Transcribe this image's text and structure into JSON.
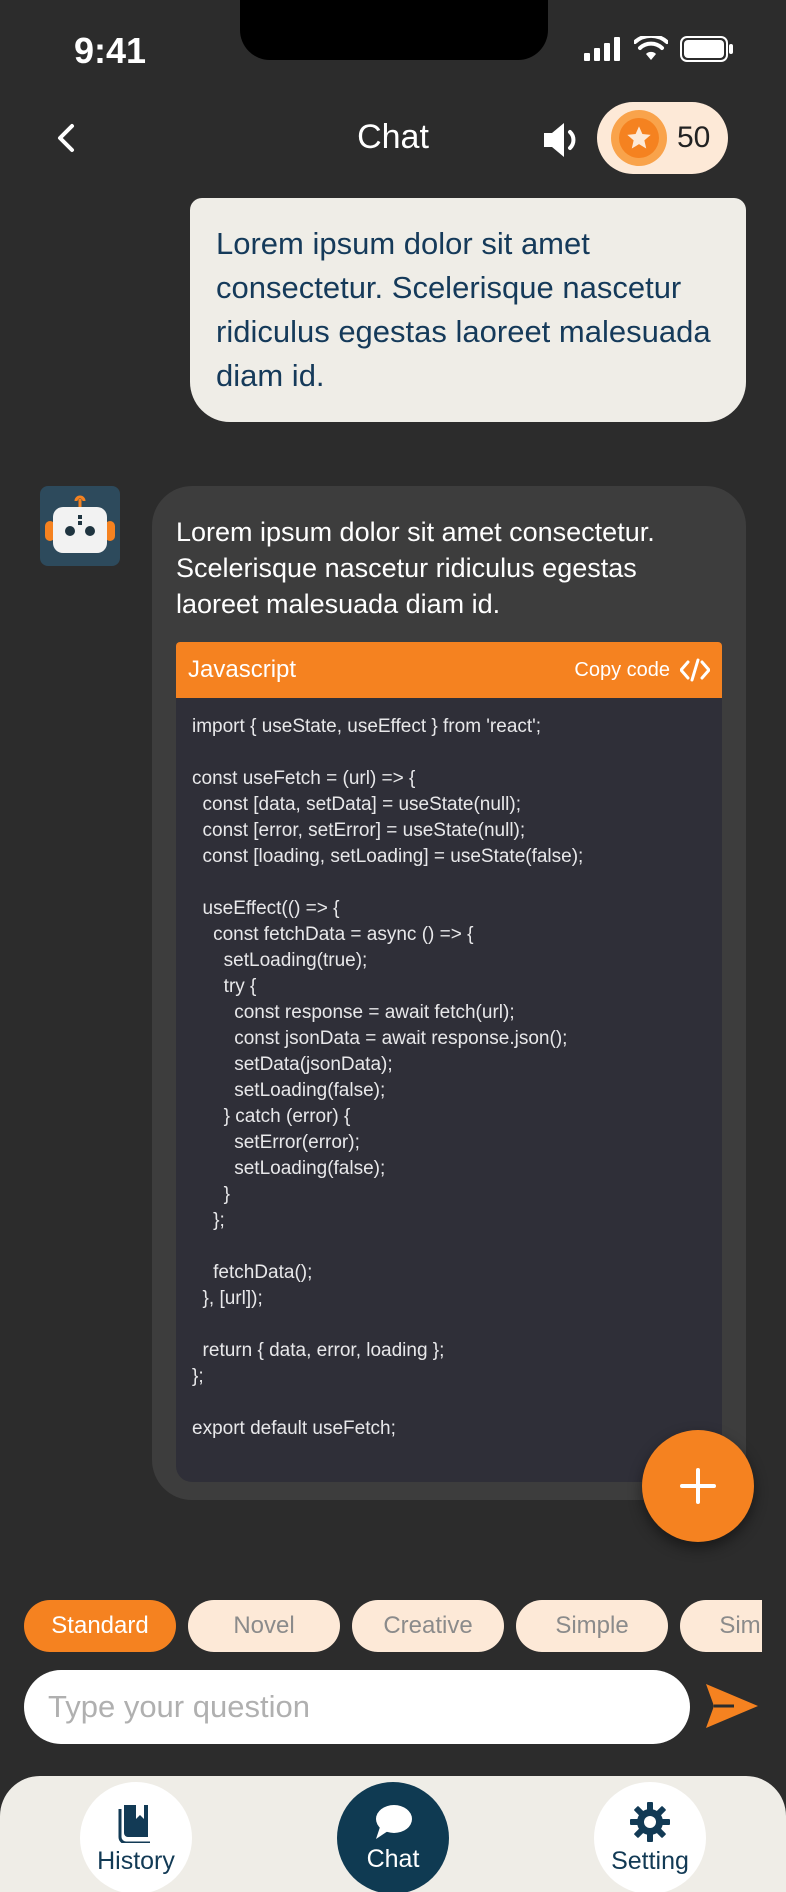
{
  "status_bar": {
    "time": "9:41"
  },
  "header": {
    "title": "Chat",
    "coins": "50"
  },
  "user_message": "Lorem ipsum dolor sit amet consectetur. Scelerisque nascetur ridiculus egestas laoreet malesuada diam id.",
  "bot_message": {
    "text": "Lorem ipsum dolor sit amet consectetur. Scelerisque nascetur ridiculus egestas laoreet malesuada diam id.",
    "code_language": "Javascript",
    "copy_label": "Copy code",
    "code": "import { useState, useEffect } from 'react';\n\nconst useFetch = (url) => {\n  const [data, setData] = useState(null);\n  const [error, setError] = useState(null);\n  const [loading, setLoading] = useState(false);\n\n  useEffect(() => {\n    const fetchData = async () => {\n      setLoading(true);\n      try {\n        const response = await fetch(url);\n        const jsonData = await response.json();\n        setData(jsonData);\n        setLoading(false);\n      } catch (error) {\n        setError(error);\n        setLoading(false);\n      }\n    };\n\n    fetchData();\n  }, [url]);\n\n  return { data, error, loading };\n};\n\nexport default useFetch;"
  },
  "modes": [
    {
      "label": "Standard",
      "active": true
    },
    {
      "label": "Novel",
      "active": false
    },
    {
      "label": "Creative",
      "active": false
    },
    {
      "label": "Simple",
      "active": false
    },
    {
      "label": "Simple",
      "active": false
    }
  ],
  "input": {
    "placeholder": "Type your question"
  },
  "bottom_nav": {
    "history": "History",
    "chat": "Chat",
    "setting": "Setting"
  },
  "colors": {
    "accent": "#f58220",
    "background": "#2c2c2c",
    "navy": "#0f3a52",
    "cream": "#efede7"
  }
}
